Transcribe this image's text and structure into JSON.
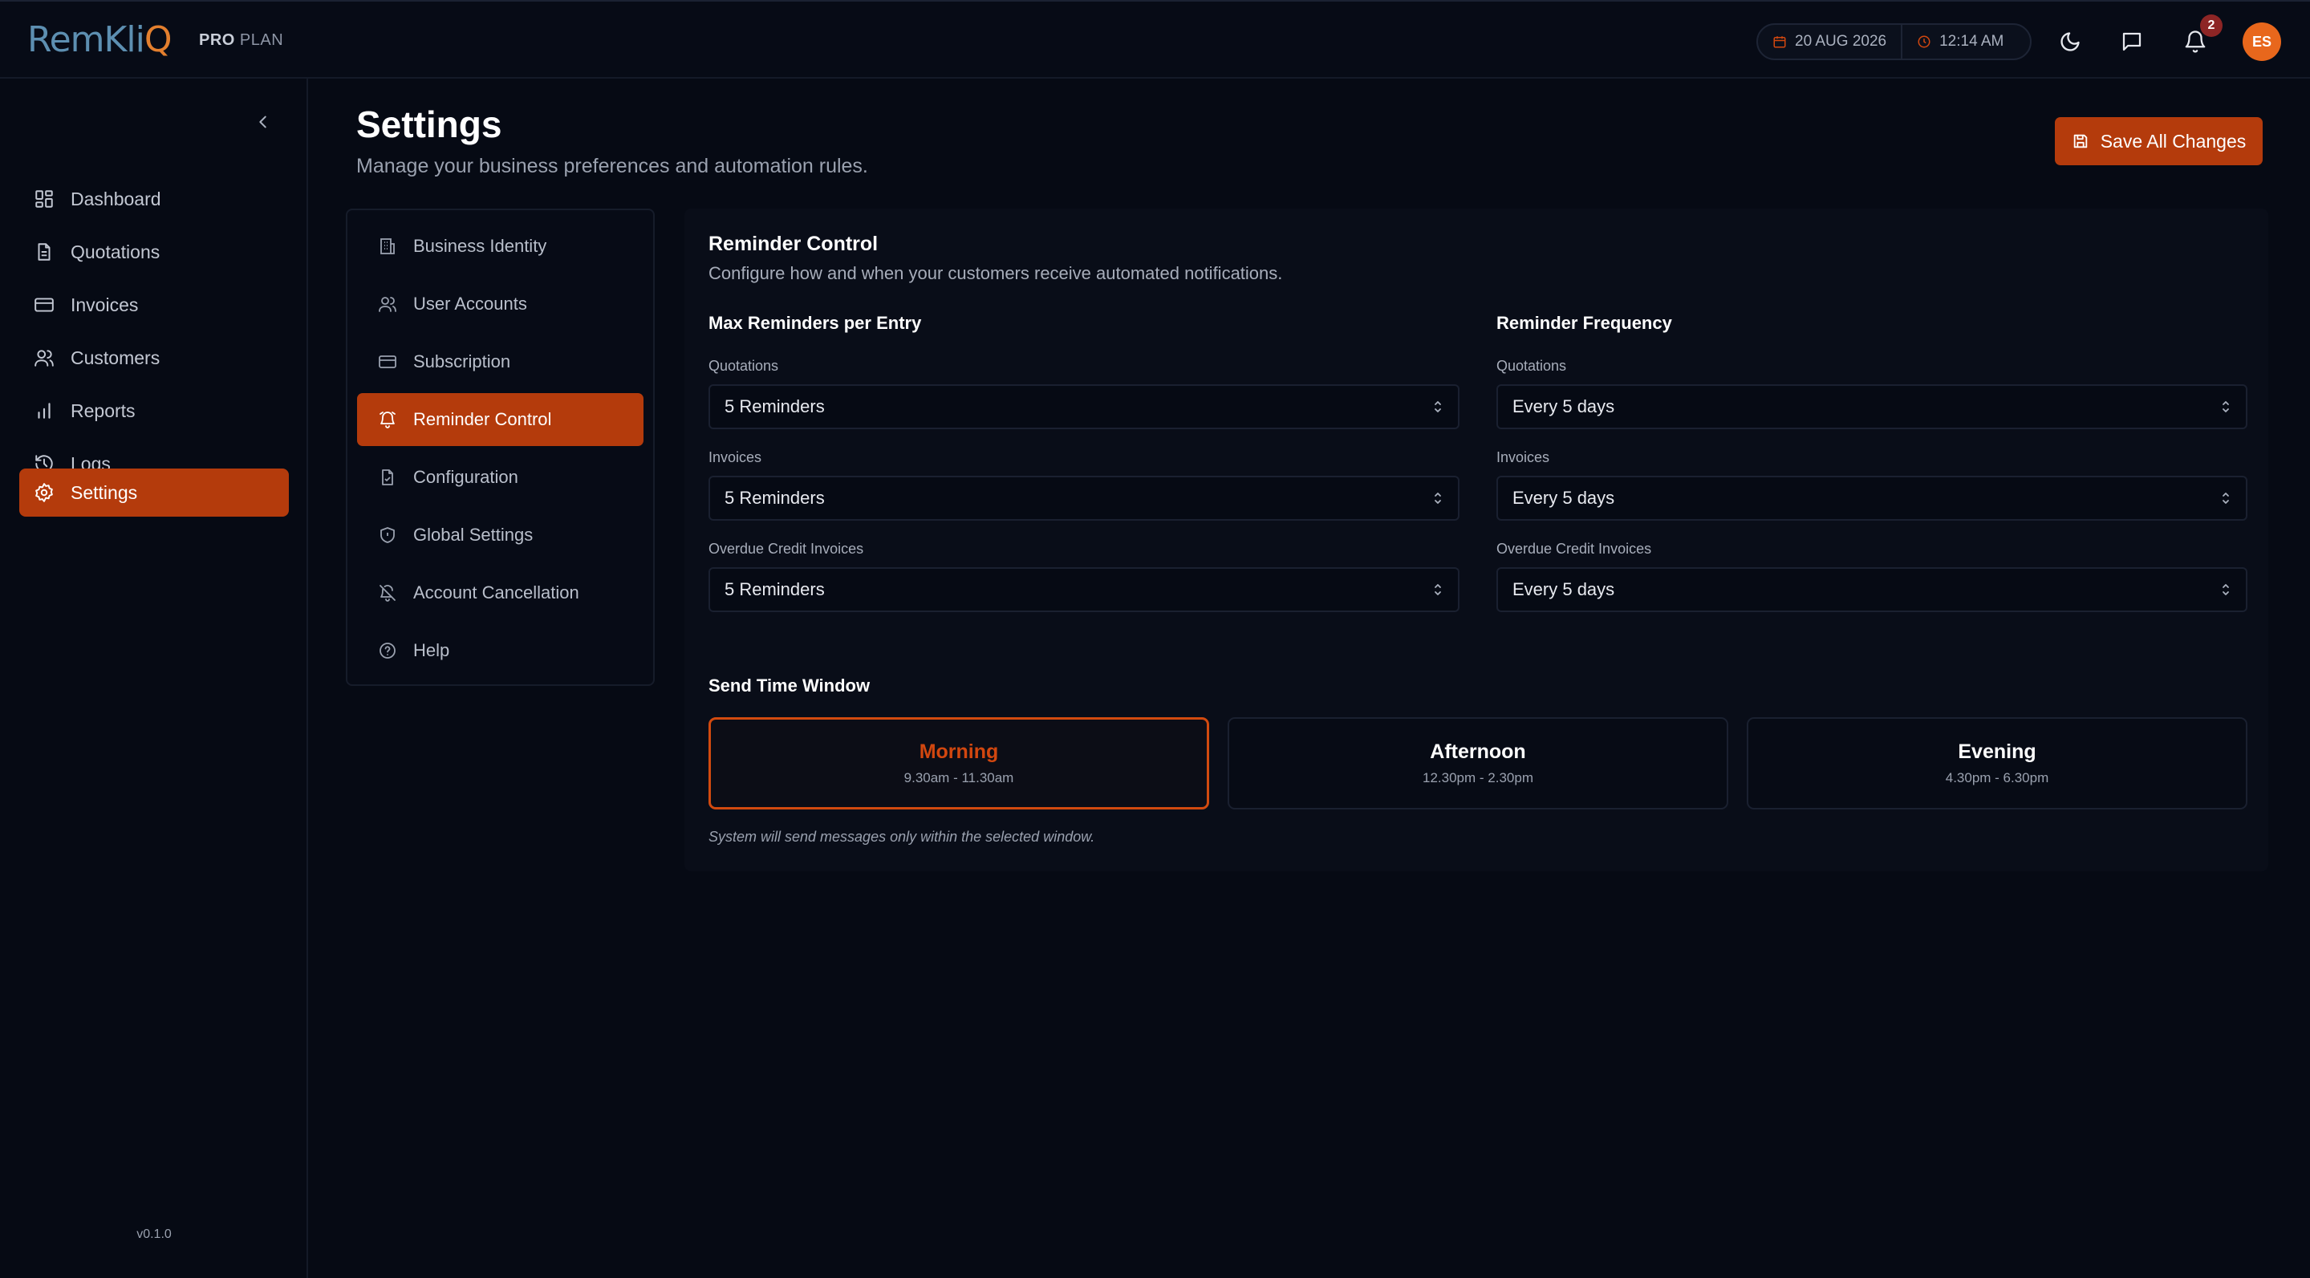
{
  "header": {
    "logo_main": "RemKli",
    "logo_accent": "Q",
    "plan_bold": "PRO",
    "plan_rest": "PLAN",
    "date": "20 AUG 2026",
    "time": "12:14 AM",
    "notification_count": "2",
    "avatar_initials": "ES",
    "icons": [
      "calendar-icon",
      "clock-icon",
      "moon-icon",
      "chat-icon",
      "bell-icon"
    ]
  },
  "sidebar": {
    "items": [
      {
        "label": "Dashboard",
        "icon": "dashboard-icon"
      },
      {
        "label": "Quotations",
        "icon": "document-icon"
      },
      {
        "label": "Invoices",
        "icon": "card-icon"
      },
      {
        "label": "Customers",
        "icon": "users-icon"
      },
      {
        "label": "Reports",
        "icon": "bar-chart-icon"
      },
      {
        "label": "Logs",
        "icon": "history-icon"
      },
      {
        "label": "Settings",
        "icon": "gear-icon",
        "active": true
      }
    ],
    "version": "v0.1.0"
  },
  "page": {
    "title": "Settings",
    "subtitle": "Manage your business preferences and automation rules.",
    "save_label": "Save All Changes"
  },
  "settings_menu": {
    "items": [
      {
        "label": "Business Identity",
        "icon": "building-icon"
      },
      {
        "label": "User Accounts",
        "icon": "users-icon"
      },
      {
        "label": "Subscription",
        "icon": "card-icon"
      },
      {
        "label": "Reminder Control",
        "icon": "alarm-icon",
        "active": true
      },
      {
        "label": "Configuration",
        "icon": "file-check-icon"
      },
      {
        "label": "Global Settings",
        "icon": "shield-icon"
      },
      {
        "label": "Account Cancellation",
        "icon": "alarm-off-icon"
      },
      {
        "label": "Help",
        "icon": "help-circle-icon"
      }
    ]
  },
  "reminder": {
    "title": "Reminder Control",
    "subtitle": "Configure how and when your customers receive automated notifications.",
    "max_heading": "Max Reminders per Entry",
    "freq_heading": "Reminder Frequency",
    "max": [
      {
        "label": "Quotations",
        "value": "5 Reminders"
      },
      {
        "label": "Invoices",
        "value": "5 Reminders"
      },
      {
        "label": "Overdue Credit Invoices",
        "value": "5 Reminders"
      }
    ],
    "freq": [
      {
        "label": "Quotations",
        "value": "Every 5 days"
      },
      {
        "label": "Invoices",
        "value": "Every 5 days"
      },
      {
        "label": "Overdue Credit Invoices",
        "value": "Every 5 days"
      }
    ],
    "window_heading": "Send Time Window",
    "windows": [
      {
        "name": "Morning",
        "time": "9.30am - 11.30am",
        "selected": true
      },
      {
        "name": "Afternoon",
        "time": "12.30pm - 2.30pm"
      },
      {
        "name": "Evening",
        "time": "4.30pm - 6.30pm"
      }
    ],
    "window_note": "System will send messages only within the selected window."
  },
  "colors": {
    "accent": "#b43b0c",
    "accent_text": "#d2470f",
    "background": "#060a14",
    "badge": "#8d2525",
    "avatar": "#e8671c"
  }
}
